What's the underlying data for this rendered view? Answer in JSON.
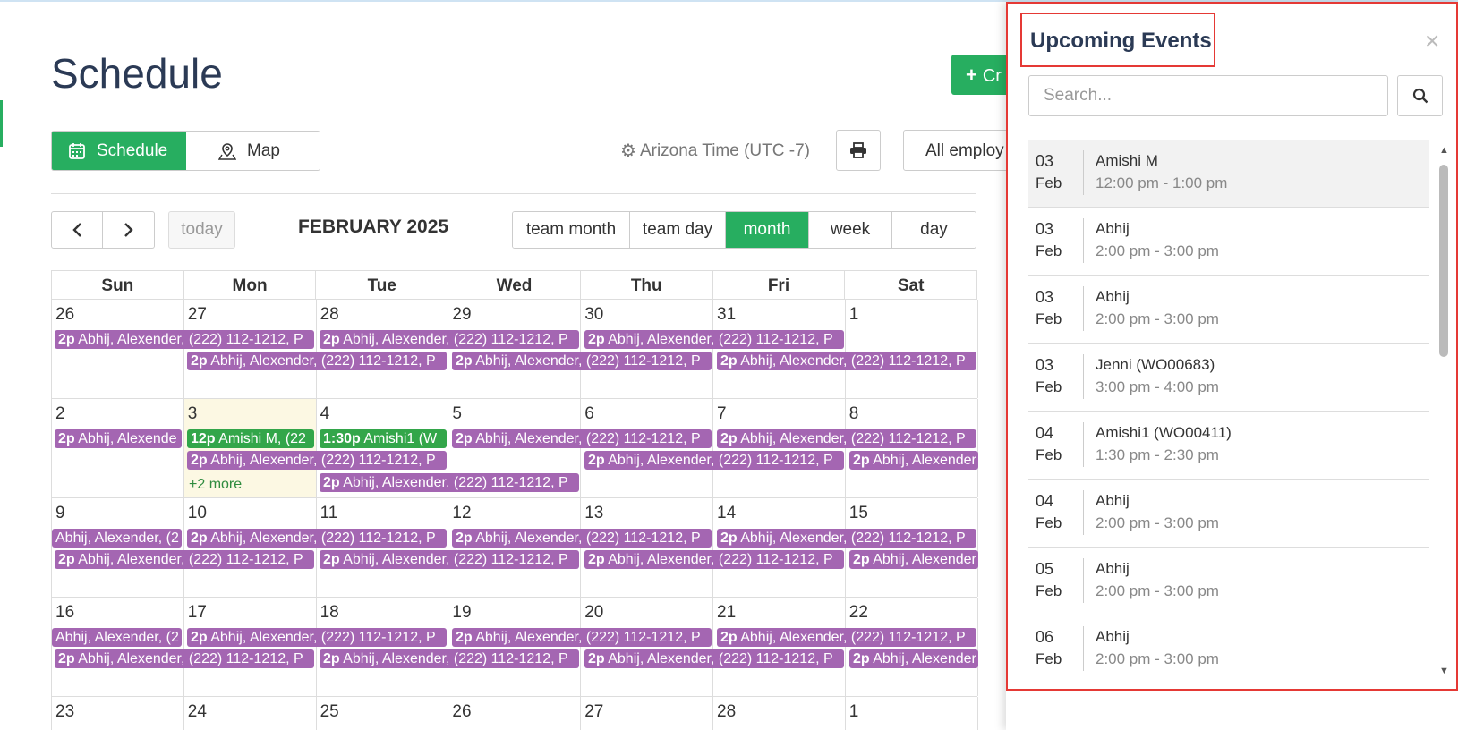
{
  "page": {
    "title": "Schedule"
  },
  "header": {
    "create_label": "Cr",
    "create_icon": "plus-icon",
    "view_tabs": [
      {
        "label": "Schedule",
        "icon": "calendar-icon"
      },
      {
        "label": "Map",
        "icon": "map-pin-icon"
      }
    ],
    "timezone": "Arizona Time (UTC -7)",
    "employee_filter": "All employ"
  },
  "toolbar": {
    "prev": "‹",
    "next": "›",
    "today": "today",
    "month_title": "FEBRUARY 2025",
    "ranges": [
      "team month",
      "team day",
      "month",
      "week",
      "day"
    ],
    "active_range": "month"
  },
  "calendar": {
    "weekdays": [
      "Sun",
      "Mon",
      "Tue",
      "Wed",
      "Thu",
      "Fri",
      "Sat"
    ],
    "weeks": [
      {
        "days": [
          "26",
          "27",
          "28",
          "29",
          "30",
          "31",
          "1"
        ]
      },
      {
        "days": [
          "2",
          "3",
          "4",
          "5",
          "6",
          "7",
          "8"
        ],
        "more": "+2 more"
      },
      {
        "days": [
          "9",
          "10",
          "11",
          "12",
          "13",
          "14",
          "15"
        ]
      },
      {
        "days": [
          "16",
          "17",
          "18",
          "19",
          "20",
          "21",
          "22"
        ]
      },
      {
        "days": [
          "23",
          "24",
          "25",
          "26",
          "27",
          "28",
          "1"
        ]
      }
    ],
    "event_text": {
      "abhij_time": "2p",
      "abhij_label": "Abhij, Alexender, (222) 112-1212, P",
      "abhij_cut": "Abhij, Alexende",
      "abhij_cut2": "Abhij, Alexender, (2",
      "abhij_cut3": "Abhij, Alexender",
      "amishi_time": "12p",
      "amishi_label": "Amishi M, (22",
      "amishi1_time": "1:30p",
      "amishi1_label": "Amishi1 (W"
    },
    "colors": {
      "purple": "#a466b2",
      "green": "#33a64a",
      "today_bg": "#fcf8e3"
    }
  },
  "panel": {
    "title": "Upcoming Events",
    "close": "×",
    "search_placeholder": "Search...",
    "events": [
      {
        "day": "03",
        "month": "Feb",
        "name": "Amishi M",
        "time": "12:00 pm - 1:00 pm"
      },
      {
        "day": "03",
        "month": "Feb",
        "name": "Abhij",
        "time": "2:00 pm - 3:00 pm"
      },
      {
        "day": "03",
        "month": "Feb",
        "name": "Abhij",
        "time": "2:00 pm - 3:00 pm"
      },
      {
        "day": "03",
        "month": "Feb",
        "name": "Jenni (WO00683)",
        "time": "3:00 pm - 4:00 pm"
      },
      {
        "day": "04",
        "month": "Feb",
        "name": "Amishi1 (WO00411)",
        "time": "1:30 pm - 2:30 pm"
      },
      {
        "day": "04",
        "month": "Feb",
        "name": "Abhij",
        "time": "2:00 pm - 3:00 pm"
      },
      {
        "day": "05",
        "month": "Feb",
        "name": "Abhij",
        "time": "2:00 pm - 3:00 pm"
      },
      {
        "day": "06",
        "month": "Feb",
        "name": "Abhij",
        "time": "2:00 pm - 3:00 pm"
      }
    ]
  }
}
